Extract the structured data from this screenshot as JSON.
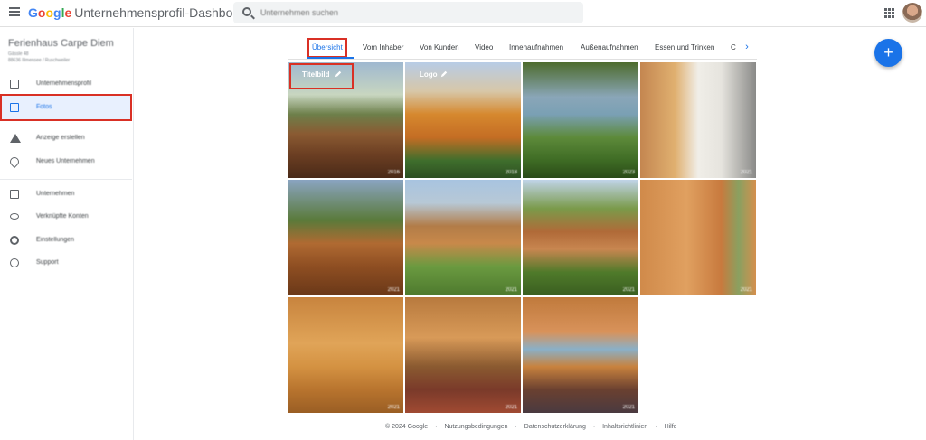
{
  "header": {
    "brand_g": [
      "G",
      "o",
      "o",
      "g",
      "l",
      "e"
    ],
    "title": "Unternehmensprofil-Dashboard",
    "search_placeholder": "Unternehmen suchen"
  },
  "sidebar": {
    "business_name": "Ferienhaus Carpe Diem",
    "business_line1": "Gässle 48",
    "business_line2": "88636 Illmensee / Ruschweiler",
    "items": [
      {
        "label": "Unternehmensprofil",
        "icon": "profile-icon"
      },
      {
        "label": "Fotos",
        "icon": "photos-icon",
        "active": true
      },
      {
        "label": "Anzeige erstellen",
        "icon": "ads-icon"
      },
      {
        "label": "Neues Unternehmen",
        "icon": "location-pin-icon"
      },
      {
        "label": "Unternehmen",
        "icon": "store-icon"
      },
      {
        "label": "Verknüpfte Konten",
        "icon": "link-icon"
      },
      {
        "label": "Einstellungen",
        "icon": "gear-icon"
      },
      {
        "label": "Support",
        "icon": "help-icon"
      }
    ]
  },
  "tabs": [
    "Übersicht",
    "Vom Inhaber",
    "Von Kunden",
    "Video",
    "Innenaufnahmen",
    "Außenaufnahmen",
    "Essen und Trinken",
    "C"
  ],
  "photos": {
    "cover_label": "Titelbild",
    "logo_label": "Logo",
    "years": [
      "2016",
      "2018",
      "2023",
      "2021",
      "2021",
      "2021",
      "2021",
      "2021",
      "2021",
      "2021",
      "2021"
    ]
  },
  "footer": [
    "© 2024 Google",
    "·",
    "Nutzungsbedingungen",
    "·",
    "Datenschutzerklärung",
    "·",
    "Inhaltsrichtlinien",
    "·",
    "Hilfe"
  ]
}
